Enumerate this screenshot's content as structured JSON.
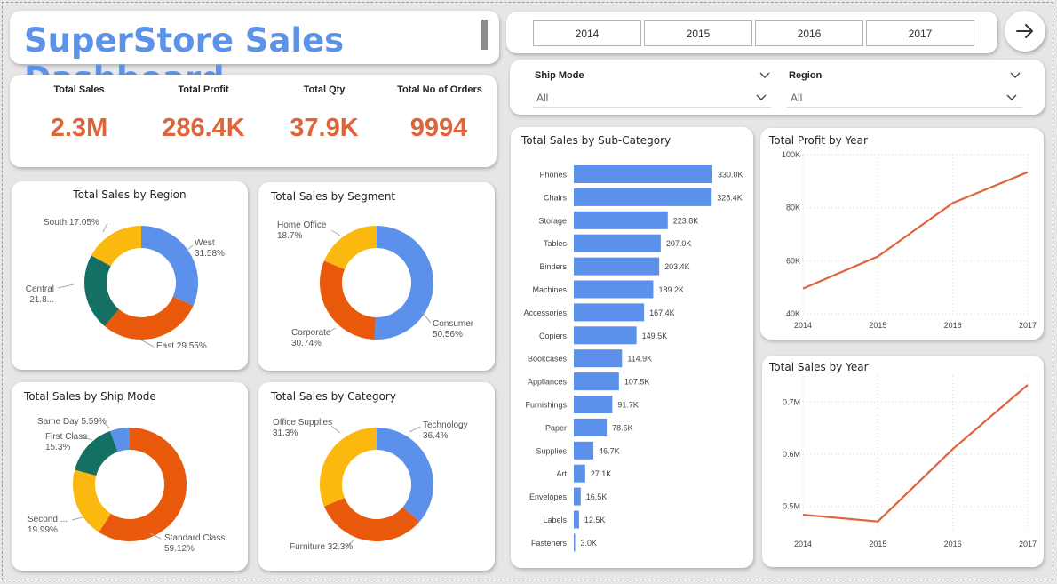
{
  "dashboard_title": "SuperStore Sales Dashboard",
  "kpis": [
    {
      "label": "Total Sales",
      "value": "2.3M"
    },
    {
      "label": "Total Profit",
      "value": "286.4K"
    },
    {
      "label": "Total Qty",
      "value": "37.9K"
    },
    {
      "label": "Total No of Orders",
      "value": "9994"
    }
  ],
  "year_buttons": [
    "2014",
    "2015",
    "2016",
    "2017"
  ],
  "slicers": {
    "ship_mode": {
      "label": "Ship Mode",
      "value": "All"
    },
    "region": {
      "label": "Region",
      "value": "All"
    }
  },
  "icons": {
    "next": "arrow-right-icon",
    "dropdown": "chevron-down-icon"
  },
  "colors": {
    "title": "#5c93e8",
    "kpi": "#e0643a",
    "blue": "#5b91ea",
    "orange": "#e8590c",
    "yellow": "#fbb90f",
    "teal": "#147063",
    "line": "#e0643a"
  },
  "chart_data": [
    {
      "id": "region",
      "type": "pie",
      "variant": "donut",
      "title": "Total Sales by Region",
      "slices": [
        {
          "name": "West",
          "value": 31.58,
          "label": [
            "West",
            "31.58%"
          ],
          "color": "#5b91ea"
        },
        {
          "name": "East",
          "value": 29.55,
          "label": [
            "East 29.55%"
          ],
          "color": "#e8590c"
        },
        {
          "name": "Central",
          "value": 21.82,
          "label": [
            "Central",
            "21.8..."
          ],
          "color": "#147063"
        },
        {
          "name": "South",
          "value": 17.05,
          "label": [
            "South 17.05%"
          ],
          "color": "#fbb90f"
        }
      ]
    },
    {
      "id": "segment",
      "type": "pie",
      "variant": "donut",
      "title": "Total Sales by Segment",
      "slices": [
        {
          "name": "Consumer",
          "value": 50.56,
          "label": [
            "Consumer",
            "50.56%"
          ],
          "color": "#5b91ea"
        },
        {
          "name": "Corporate",
          "value": 30.74,
          "label": [
            "Corporate",
            "30.74%"
          ],
          "color": "#e8590c"
        },
        {
          "name": "Home Office",
          "value": 18.7,
          "label": [
            "Home Office",
            "18.7%"
          ],
          "color": "#fbb90f"
        }
      ]
    },
    {
      "id": "shipmode",
      "type": "pie",
      "variant": "donut",
      "title": "Total Sales by Ship Mode",
      "slices": [
        {
          "name": "Standard Class",
          "value": 59.12,
          "label": [
            "Standard Class",
            "59.12%"
          ],
          "color": "#e8590c"
        },
        {
          "name": "Second Class",
          "value": 19.99,
          "label": [
            "Second ...",
            "19.99%"
          ],
          "color": "#fbb90f"
        },
        {
          "name": "First Class",
          "value": 15.3,
          "label": [
            "First Class",
            "15.3%"
          ],
          "color": "#147063"
        },
        {
          "name": "Same Day",
          "value": 5.59,
          "label": [
            "Same Day 5.59%"
          ],
          "color": "#5b91ea"
        }
      ]
    },
    {
      "id": "category",
      "type": "pie",
      "variant": "donut",
      "title": "Total Sales by Category",
      "slices": [
        {
          "name": "Technology",
          "value": 36.4,
          "label": [
            "Technology",
            "36.4%"
          ],
          "color": "#5b91ea"
        },
        {
          "name": "Furniture",
          "value": 32.3,
          "label": [
            "Furniture 32.3%"
          ],
          "color": "#e8590c"
        },
        {
          "name": "Office Supplies",
          "value": 31.3,
          "label": [
            "Office Supplies",
            "31.3%"
          ],
          "color": "#fbb90f"
        }
      ]
    },
    {
      "id": "subcategory",
      "type": "bar",
      "orientation": "horizontal",
      "title": "Total Sales by Sub-Category",
      "categories": [
        "Phones",
        "Chairs",
        "Storage",
        "Tables",
        "Binders",
        "Machines",
        "Accessories",
        "Copiers",
        "Bookcases",
        "Appliances",
        "Furnishings",
        "Paper",
        "Supplies",
        "Art",
        "Envelopes",
        "Labels",
        "Fasteners"
      ],
      "values": [
        330.0,
        328.4,
        223.8,
        207.0,
        203.4,
        189.2,
        167.4,
        149.5,
        114.9,
        107.5,
        91.7,
        78.5,
        46.7,
        27.1,
        16.5,
        12.5,
        3.0
      ],
      "value_labels": [
        "330.0K",
        "328.4K",
        "223.8K",
        "207.0K",
        "203.4K",
        "189.2K",
        "167.4K",
        "149.5K",
        "114.9K",
        "107.5K",
        "91.7K",
        "78.5K",
        "46.7K",
        "27.1K",
        "16.5K",
        "12.5K",
        "3.0K"
      ],
      "unit": "K",
      "color": "#5b91ea"
    },
    {
      "id": "profit_year",
      "type": "line",
      "title": "Total Profit by Year",
      "x": [
        "2014",
        "2015",
        "2016",
        "2017"
      ],
      "y": [
        49.5,
        61.6,
        81.8,
        93.4
      ],
      "ylim": [
        40,
        100
      ],
      "yticks": [
        40,
        60,
        80,
        100
      ],
      "ytick_labels": [
        "40K",
        "60K",
        "80K",
        "100K"
      ],
      "unit": "K",
      "grid": true,
      "color": "#e0643a"
    },
    {
      "id": "sales_year",
      "type": "line",
      "title": "Total Sales by Year",
      "x": [
        "2014",
        "2015",
        "2016",
        "2017"
      ],
      "y": [
        0.484,
        0.471,
        0.61,
        0.733
      ],
      "ylim": [
        0.45,
        0.75
      ],
      "yticks": [
        0.5,
        0.6,
        0.7
      ],
      "ytick_labels": [
        "0.5M",
        "0.6M",
        "0.7M"
      ],
      "unit": "M",
      "grid": true,
      "color": "#e0643a"
    }
  ]
}
